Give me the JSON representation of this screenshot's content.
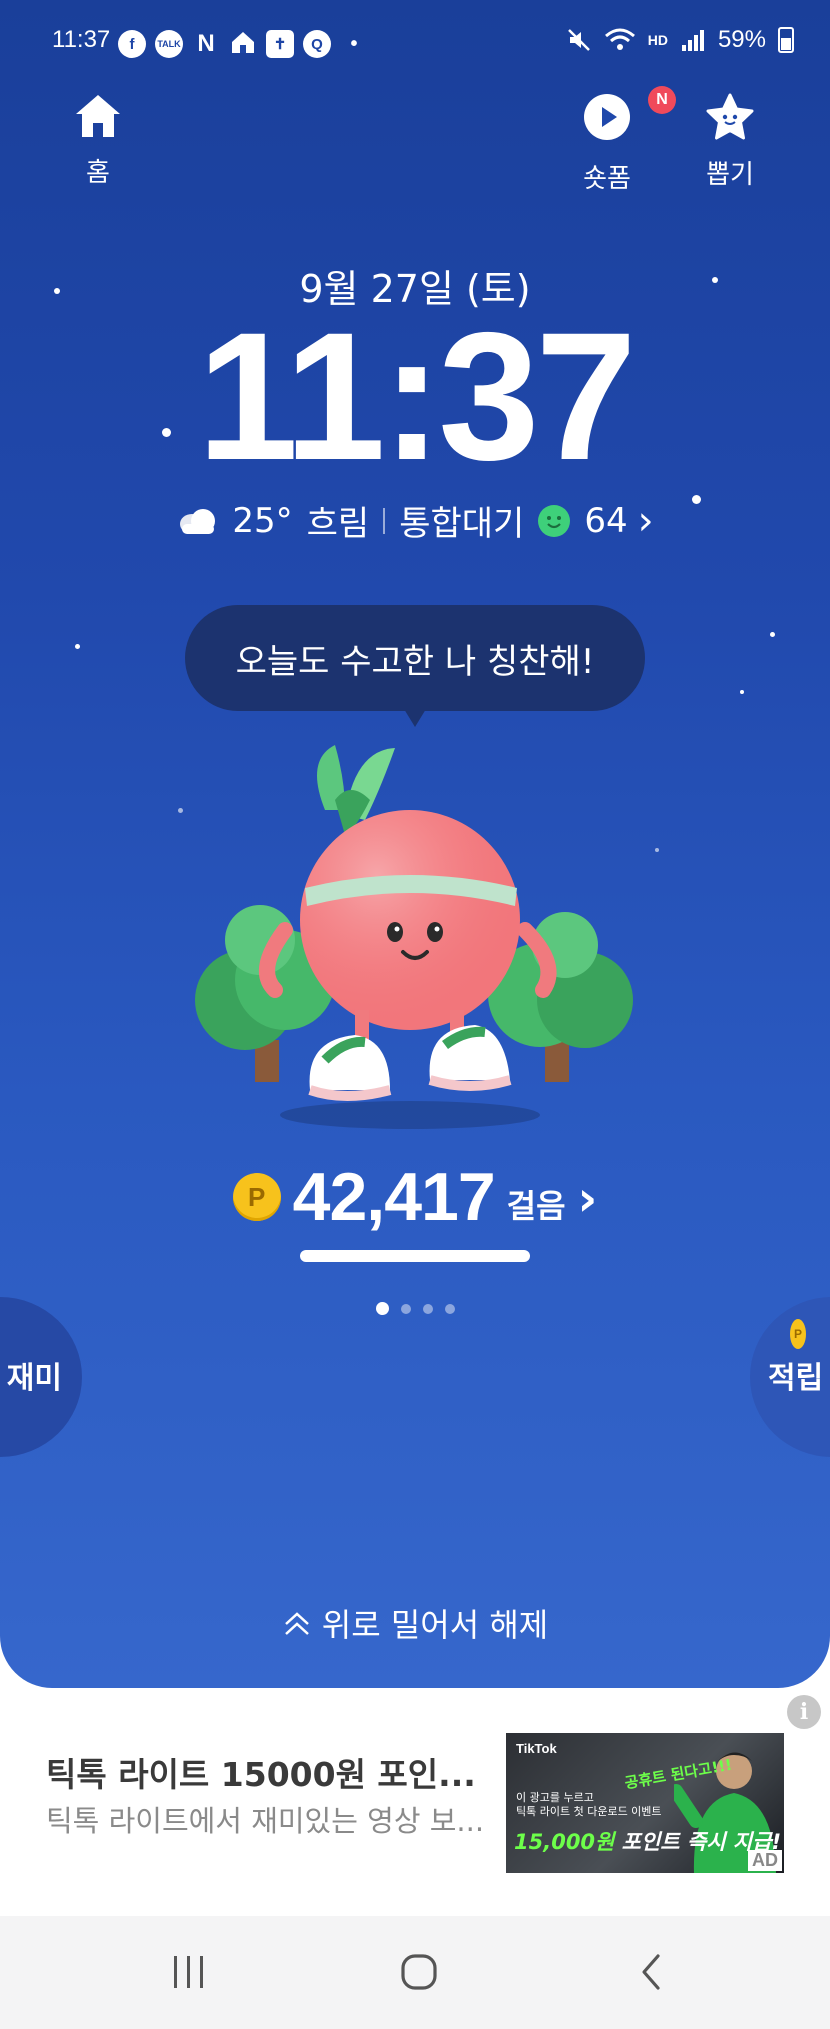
{
  "status_bar": {
    "time": "11:37",
    "notification_icons": [
      "facebook-icon",
      "kakaotalk-icon",
      "naver-icon",
      "home-app-icon",
      "bible-app-icon",
      "search-app-icon"
    ],
    "kakao_label": "TALK",
    "naver_label": "N",
    "more_dot": "•",
    "network_label": "HD",
    "battery": "59%"
  },
  "top_nav": {
    "home_label": "홈",
    "shopping_label": "숏폼",
    "shopping_badge": "N",
    "draw_label": "뽑기"
  },
  "lock": {
    "date": "9월 27일 (토)",
    "time": "11:37",
    "weather": {
      "temp": "25°",
      "condition": "흐림",
      "air_label": "통합대기",
      "air_value": "64",
      "chevron": "›"
    },
    "bubble_text": "오늘도 수고한 나 칭찬해!",
    "coin_label": "P",
    "steps": "42,417",
    "steps_unit": "걸음",
    "steps_chevron": "›",
    "page_count": 4,
    "active_page": 1,
    "left_tab": "재미",
    "right_tab": "적립",
    "right_coin": "P",
    "unlock_text": "위로 밀어서 해제"
  },
  "ad": {
    "title": "틱톡 라이트 15000원 포인...",
    "description": "틱톡 라이트에서 재미있는 영상 보...",
    "info": "i",
    "image": {
      "brand": "TikTok",
      "stamp": "공휴트 된다고!!!",
      "small_line1": "이 광고를 누르고",
      "small_line2": "틱톡 라이트 첫 다운로드 이벤트",
      "amount": "15,000원",
      "headline": "포인트 즉시 지급!",
      "ad_tag": "AD"
    }
  },
  "colors": {
    "lock_bg_top": "#1a3f9a",
    "lock_bg_bottom": "#3667cc",
    "badge_red": "#f04a5b",
    "coin_yellow": "#f7c21c",
    "air_good_green": "#3ed07a"
  }
}
